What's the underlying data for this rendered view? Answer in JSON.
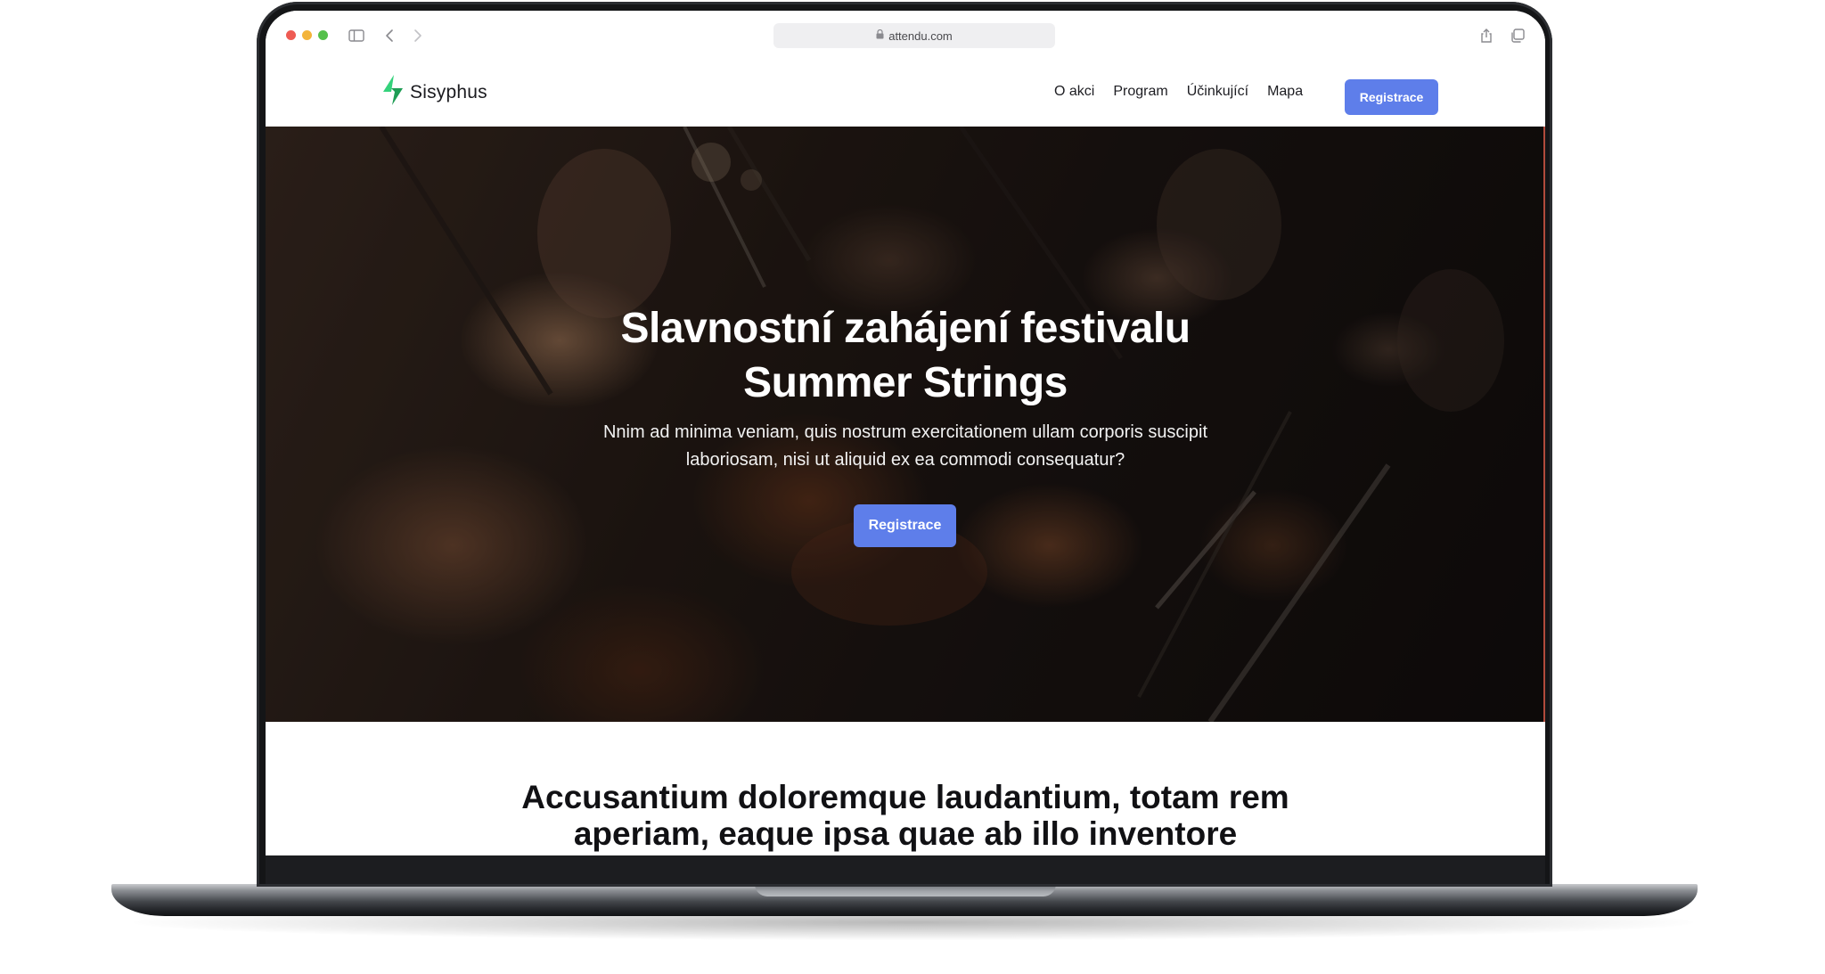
{
  "browser": {
    "url": "attendu.com",
    "icons": [
      "sidebar-icon",
      "back-icon",
      "forward-icon",
      "lock-icon",
      "share-icon",
      "tabs-icon"
    ]
  },
  "site": {
    "brand": "Sisyphus",
    "logo_icon": "lightning-logo-icon",
    "nav": {
      "items": [
        "O akci",
        "Program",
        "Účinkující",
        "Mapa"
      ],
      "cta": "Registrace"
    }
  },
  "hero": {
    "title": "Slavnostní zahájení festivalu Summer Strings",
    "text": "Nnim ad minima veniam, quis nostrum exercitationem ullam corporis suscipit laboriosam, nisi ut aliquid ex ea commodi consequatur?",
    "cta": "Registrace"
  },
  "section": {
    "heading": "Accusantium doloremque laudantium, totam rem aperiam, eaque ipsa quae ab illo inventore"
  },
  "colors": {
    "accent": "#5e7eea",
    "logo_green_dark": "#1f9d55",
    "logo_green_light": "#34d27b",
    "traffic_red": "#ee5b53",
    "traffic_yellow": "#f3b43a",
    "traffic_green": "#55c04b"
  }
}
